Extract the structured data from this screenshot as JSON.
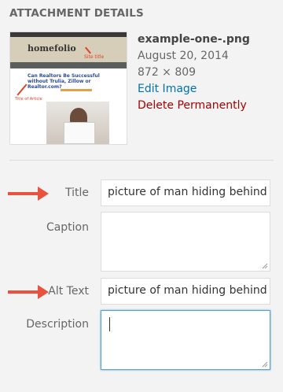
{
  "heading": "ATTACHMENT DETAILS",
  "thumbnail": {
    "logo": "homefolio",
    "logo_note": "Site title",
    "article_title": "Can Realtors Be Successful without Trulia, Zillow or Realtor.com?",
    "article_note": "Title of Article"
  },
  "details": {
    "filename": "example-one-.png",
    "date": "August 20, 2014",
    "dimensions": "872 × 809",
    "edit_link": "Edit Image",
    "delete_link": "Delete Permanently"
  },
  "form": {
    "title_label": "Title",
    "title_value": "picture of man hiding behind",
    "caption_label": "Caption",
    "caption_value": "",
    "alt_label": "Alt Text",
    "alt_value": "picture of man hiding behind",
    "description_label": "Description",
    "description_value": ""
  },
  "colors": {
    "arrow": "#e8533f",
    "link": "#0073aa",
    "delete": "#aa0000",
    "focus": "#5b9dd9"
  }
}
